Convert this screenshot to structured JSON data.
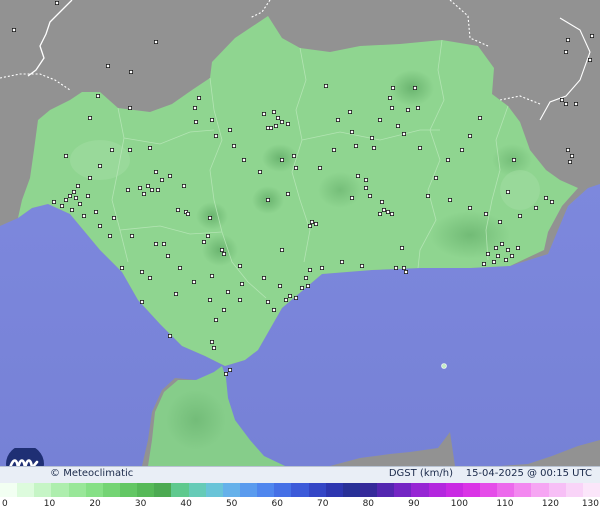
{
  "map": {
    "land_color": "#8f8f8f",
    "sea_color": "#7b86db",
    "region_base_color": "#8fd68e",
    "station_marker_count": 190
  },
  "brand": {
    "copyright_symbol": "©",
    "name": "Meteoclimatic"
  },
  "caption": {
    "variable": "DGST (km/h)",
    "datetime": "15-04-2025 @ 00:15 UTC"
  },
  "legend": {
    "colors": [
      "#f2fff2",
      "#ddfbdd",
      "#c6f5c6",
      "#aeeeae",
      "#99e799",
      "#86e086",
      "#74d474",
      "#63c764",
      "#56b958",
      "#4caa52",
      "#5fc98e",
      "#66cbb7",
      "#69c4d8",
      "#65b1ea",
      "#5a9bee",
      "#4f86ee",
      "#4570e6",
      "#3c5ad9",
      "#3446c6",
      "#2d36b0",
      "#283097",
      "#352a9a",
      "#5326b0",
      "#7425c4",
      "#9726d4",
      "#b327de",
      "#c92ae3",
      "#da34e6",
      "#e54de9",
      "#ec6aec",
      "#f388f0",
      "#f6a6f3",
      "#f7bff6",
      "#f9d4f8",
      "#fbe6fa"
    ],
    "ticks": [
      "0",
      "10",
      "20",
      "30",
      "40",
      "50",
      "60",
      "70",
      "80",
      "90",
      "100",
      "110",
      "120",
      "130"
    ],
    "max_value": 130
  }
}
